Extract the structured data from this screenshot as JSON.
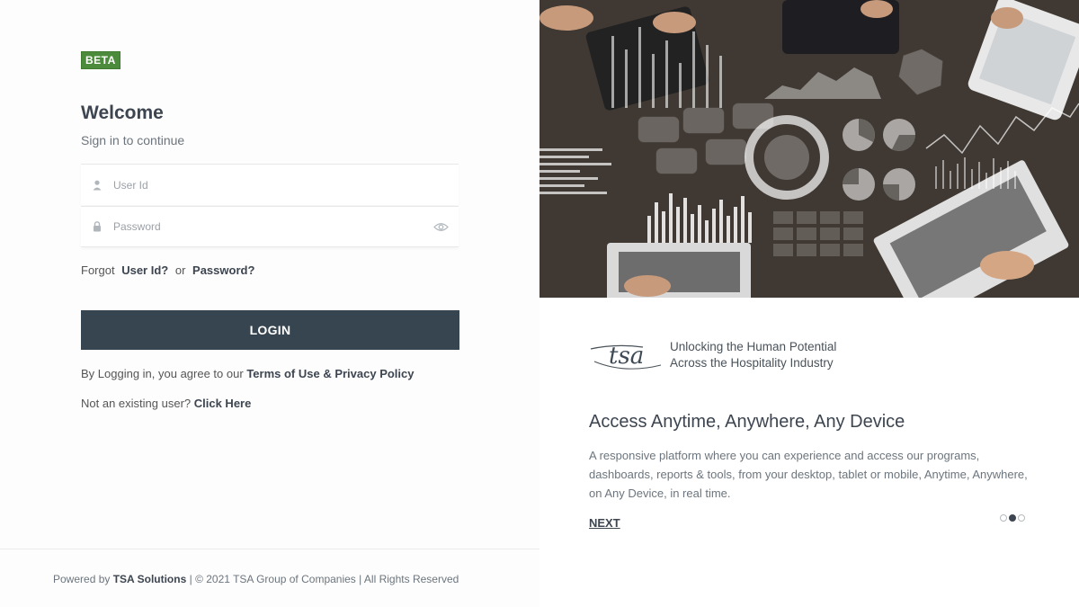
{
  "badge": "BETA",
  "heading": "Welcome",
  "subheading": "Sign in to continue",
  "form": {
    "user_placeholder": "User Id",
    "password_placeholder": "Password",
    "forgot_prefix": "Forgot",
    "forgot_user": "User Id?",
    "forgot_or": "or",
    "forgot_password": "Password?",
    "login_label": "LOGIN",
    "terms_prefix": "By Logging in, you agree to our",
    "terms_link": "Terms of Use & Privacy Policy",
    "newuser_prefix": "Not an existing user?",
    "newuser_link": "Click Here"
  },
  "footer": {
    "prefix": "Powered by",
    "company": "TSA Solutions",
    "rest": "| © 2021 TSA Group of Companies | All Rights Reserved"
  },
  "brand": {
    "tagline_line1": "Unlocking the Human Potential",
    "tagline_line2": "Across the Hospitality Industry"
  },
  "slide": {
    "title": "Access Anytime, Anywhere, Any Device",
    "text": "A responsive platform where you can experience and access our programs, dashboards, reports & tools, from your desktop, tablet or mobile, Anytime, Anywhere, on Any Device, in real time.",
    "next_label": "NEXT",
    "total": 3,
    "active": 2
  },
  "colors": {
    "accent": "#36454f",
    "badge": "#4b8b3b",
    "text": "#3d4550"
  },
  "icons": {
    "user": "user-icon",
    "lock": "lock-icon",
    "eye": "eye-icon"
  }
}
